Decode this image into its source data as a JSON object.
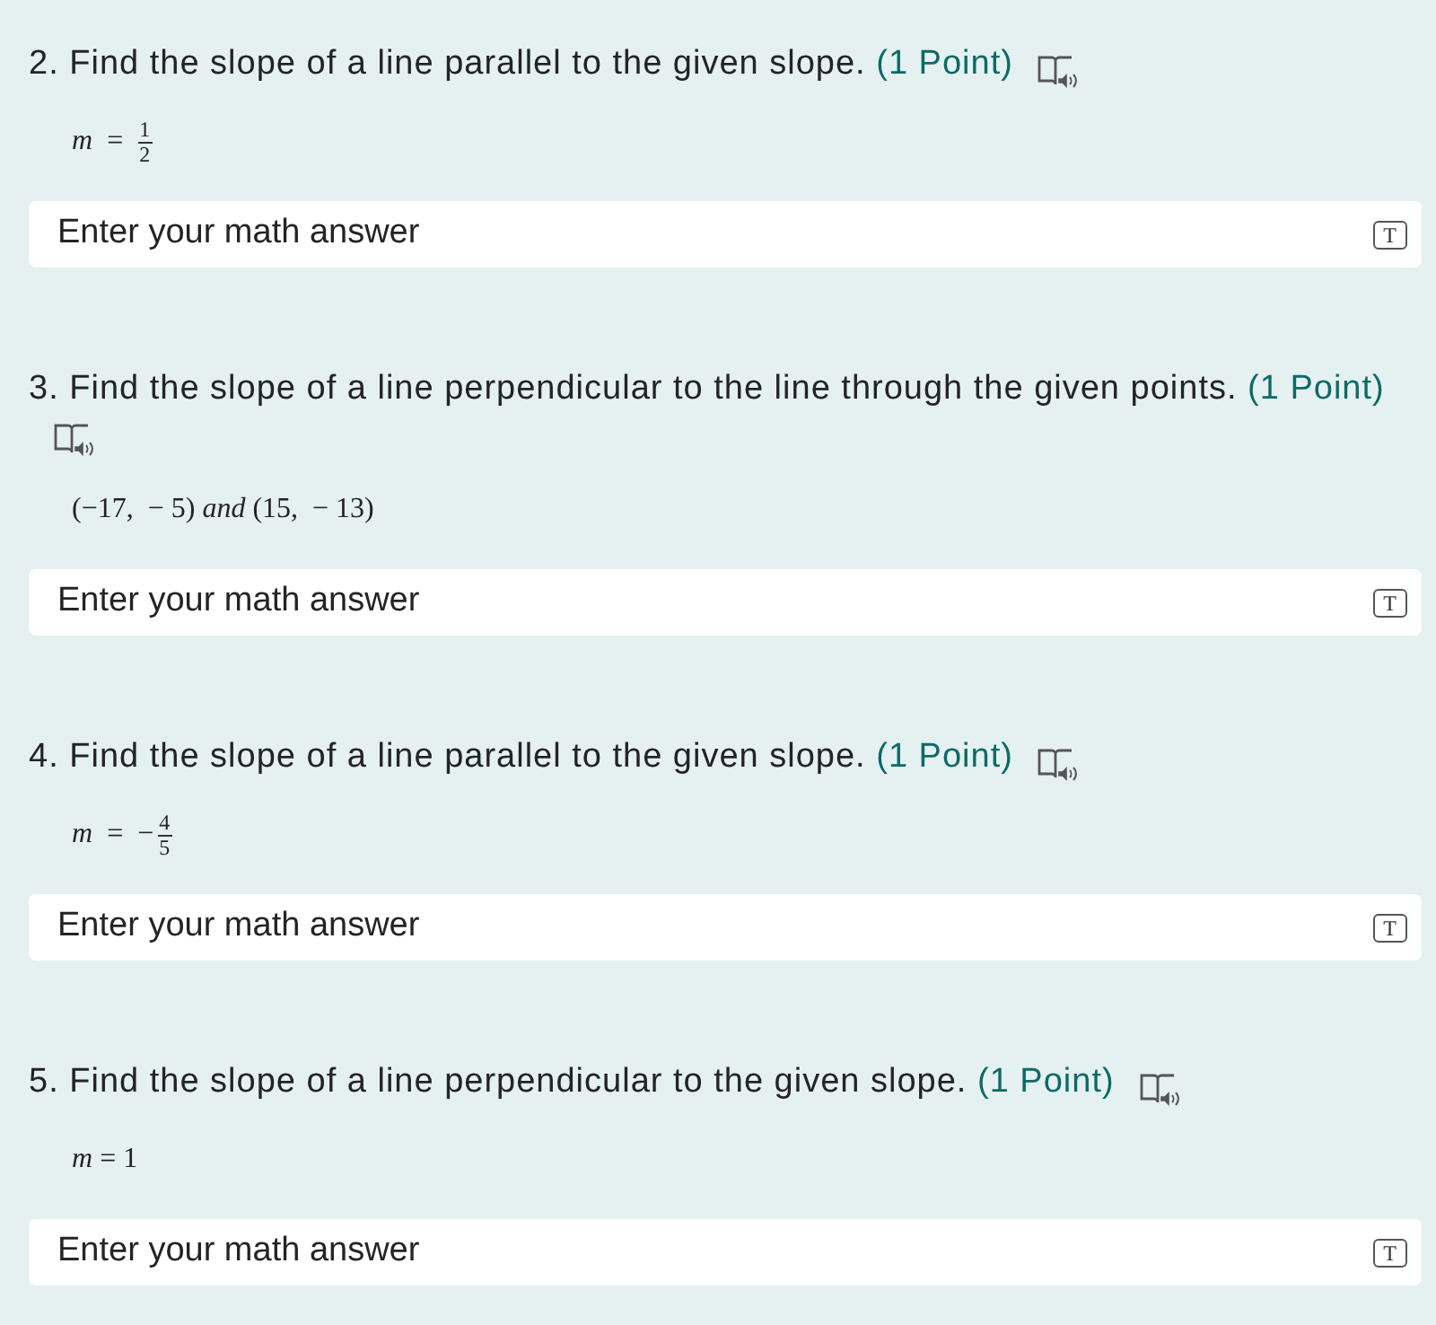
{
  "questions": [
    {
      "number": "2.",
      "text": "Find the slope of a line parallel to the given slope.",
      "points": "(1 Point)",
      "math": {
        "kind": "fraction",
        "lhs": "m",
        "relation": "=",
        "numerator": "1",
        "denominator": "2"
      },
      "answer": {
        "placeholder": "Enter your math answer",
        "mode_button": "T"
      }
    },
    {
      "number": "3.",
      "text": "Find the slope of a line perpendicular to the line through the given points.",
      "points": "(1 Point)",
      "math": {
        "kind": "inline",
        "text": "(−17,  − 5) *and* (15,  − 13)"
      },
      "answer": {
        "placeholder": "Enter your math answer",
        "mode_button": "T"
      }
    },
    {
      "number": "4.",
      "text": "Find the slope of a line parallel to the given slope.",
      "points": "(1 Point)",
      "math": {
        "kind": "fraction",
        "lhs": "m",
        "relation": "=",
        "sign": "−",
        "numerator": "4",
        "denominator": "5"
      },
      "answer": {
        "placeholder": "Enter your math answer",
        "mode_button": "T"
      }
    },
    {
      "number": "5.",
      "text": "Find the slope of a line perpendicular to the given slope.",
      "points": "(1 Point)",
      "math": {
        "kind": "inline",
        "text": "*m* = 1"
      },
      "answer": {
        "placeholder": "Enter your math answer",
        "mode_button": "T"
      }
    }
  ]
}
